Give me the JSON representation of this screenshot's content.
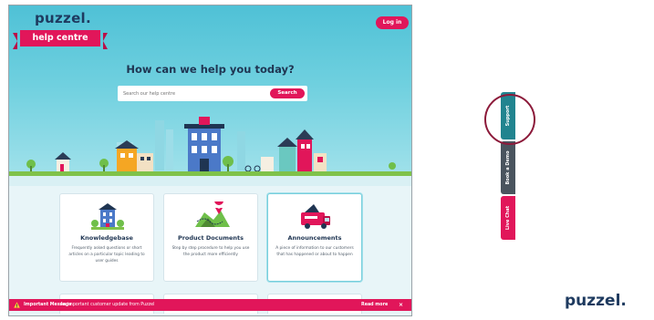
{
  "header": {
    "logo_text": "puzzel.",
    "logo_ribbon": "help centre",
    "login_label": "Log in"
  },
  "hero": {
    "title": "How can we help you today?",
    "search_placeholder": "Search our help centre",
    "search_button": "Search"
  },
  "cards": [
    {
      "title": "Knowledgebase",
      "description": "Frequently asked questions or short articles on a particular topic leading to user guides",
      "icon": "building-icon"
    },
    {
      "title": "Product Documents",
      "description": "Step by step procedure to help you use the product more efficiently",
      "icon": "map-pin-icon"
    },
    {
      "title": "Announcements",
      "description": "A piece of information to our customers that has happened or about to happen",
      "icon": "van-icon"
    }
  ],
  "alert": {
    "label": "Important Message",
    "text": "An important customer update from Puzzel",
    "more": "Read more",
    "close": "×"
  },
  "side_tabs": {
    "support": "Support",
    "book_demo": "Book a Demo",
    "live_chat": "Live Chat"
  },
  "brand": "puzzel.",
  "colors": {
    "accent": "#e1165a",
    "navy": "#1e3a5f",
    "teal": "#21848f",
    "sky": "#4fc1d6"
  }
}
